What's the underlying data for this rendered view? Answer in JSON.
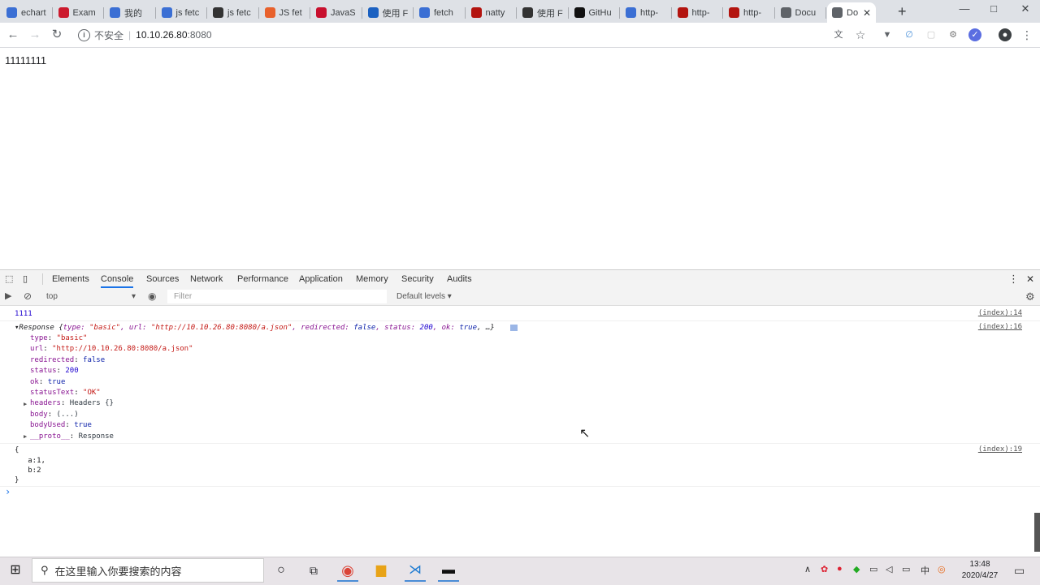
{
  "browser": {
    "tabs": [
      {
        "label": "echart",
        "icon": "baidu-paw-icon",
        "color": "#3b6fd4"
      },
      {
        "label": "Exam",
        "icon": "opera-icon",
        "color": "#cc1a2e"
      },
      {
        "label": "我的",
        "icon": "baidu-paw-icon",
        "color": "#3b6fd4"
      },
      {
        "label": "js fetc",
        "icon": "baidu-paw-icon",
        "color": "#3b6fd4"
      },
      {
        "label": "js fetc",
        "icon": "github-octocat-icon",
        "color": "#333333"
      },
      {
        "label": "JS fet",
        "icon": "csdn-icon",
        "color": "#e8612c"
      },
      {
        "label": "JavaS",
        "icon": "c-logo-icon",
        "color": "#c8102e"
      },
      {
        "label": "使用 F",
        "icon": "mdn-icon",
        "color": "#1b61c1"
      },
      {
        "label": "fetch",
        "icon": "baidu-paw-icon",
        "color": "#3b6fd4"
      },
      {
        "label": "natty",
        "icon": "n-logo-icon",
        "color": "#b3140f"
      },
      {
        "label": "使用 F",
        "icon": "github-octocat-icon",
        "color": "#333333"
      },
      {
        "label": "GitHu",
        "icon": "github-icon",
        "color": "#111111"
      },
      {
        "label": "http-",
        "icon": "baidu-paw-icon",
        "color": "#3b6fd4"
      },
      {
        "label": "http-",
        "icon": "n-logo-icon",
        "color": "#b3140f"
      },
      {
        "label": "http-",
        "icon": "n-logo-icon",
        "color": "#b3140f"
      },
      {
        "label": "Docu",
        "icon": "globe-icon",
        "color": "#5f6368"
      },
      {
        "label": "Do",
        "icon": "globe-icon",
        "color": "#5f6368",
        "active": true
      }
    ],
    "address": {
      "insecure": "不安全",
      "host": "10.10.26.80",
      "port": ":8080"
    }
  },
  "page": {
    "text": "11111111"
  },
  "devtools": {
    "tabs": [
      "Elements",
      "Console",
      "Sources",
      "Network",
      "Performance",
      "Application",
      "Memory",
      "Security",
      "Audits"
    ],
    "active_tab": "Console",
    "context": "top",
    "filter_placeholder": "Filter",
    "levels": "Default levels ▾",
    "console": {
      "log1": "1111",
      "log1_src": "(index):14",
      "resp_src": "(index):16",
      "resp_summary": {
        "prefix": "Response {",
        "type_key": "type: ",
        "type_val": "\"basic\"",
        "url_key": ", url: ",
        "url_val": "\"http://10.10.26.80:8080/a.json\"",
        "redir_key": ", redirected: ",
        "redir_val": "false",
        "status_key": ", status: ",
        "status_val": "200",
        "ok_key": ", ok: ",
        "ok_val": "true",
        "suffix": ", …}"
      },
      "props": [
        {
          "key": "type",
          "val": "\"basic\"",
          "cls": "s"
        },
        {
          "key": "url",
          "val": "\"http://10.10.26.80:8080/a.json\"",
          "cls": "s"
        },
        {
          "key": "redirected",
          "val": "false",
          "cls": "b"
        },
        {
          "key": "status",
          "val": "200",
          "cls": "n"
        },
        {
          "key": "ok",
          "val": "true",
          "cls": "b"
        },
        {
          "key": "statusText",
          "val": "\"OK\"",
          "cls": "s"
        },
        {
          "key": "headers",
          "val": "Headers {}",
          "cls": "g"
        },
        {
          "key": "body",
          "val": "(...)",
          "cls": "g"
        },
        {
          "key": "bodyUsed",
          "val": "true",
          "cls": "b"
        },
        {
          "key": "__proto__",
          "val": "Response",
          "cls": "g"
        }
      ],
      "obj_src": "(index):19",
      "obj_lines": [
        "{",
        "   a:1,",
        "   b:2",
        "}"
      ],
      "prompt": "›"
    }
  },
  "taskbar": {
    "search_placeholder": "在这里输入你要搜索的内容",
    "time": "13:48",
    "date": "2020/4/27"
  }
}
